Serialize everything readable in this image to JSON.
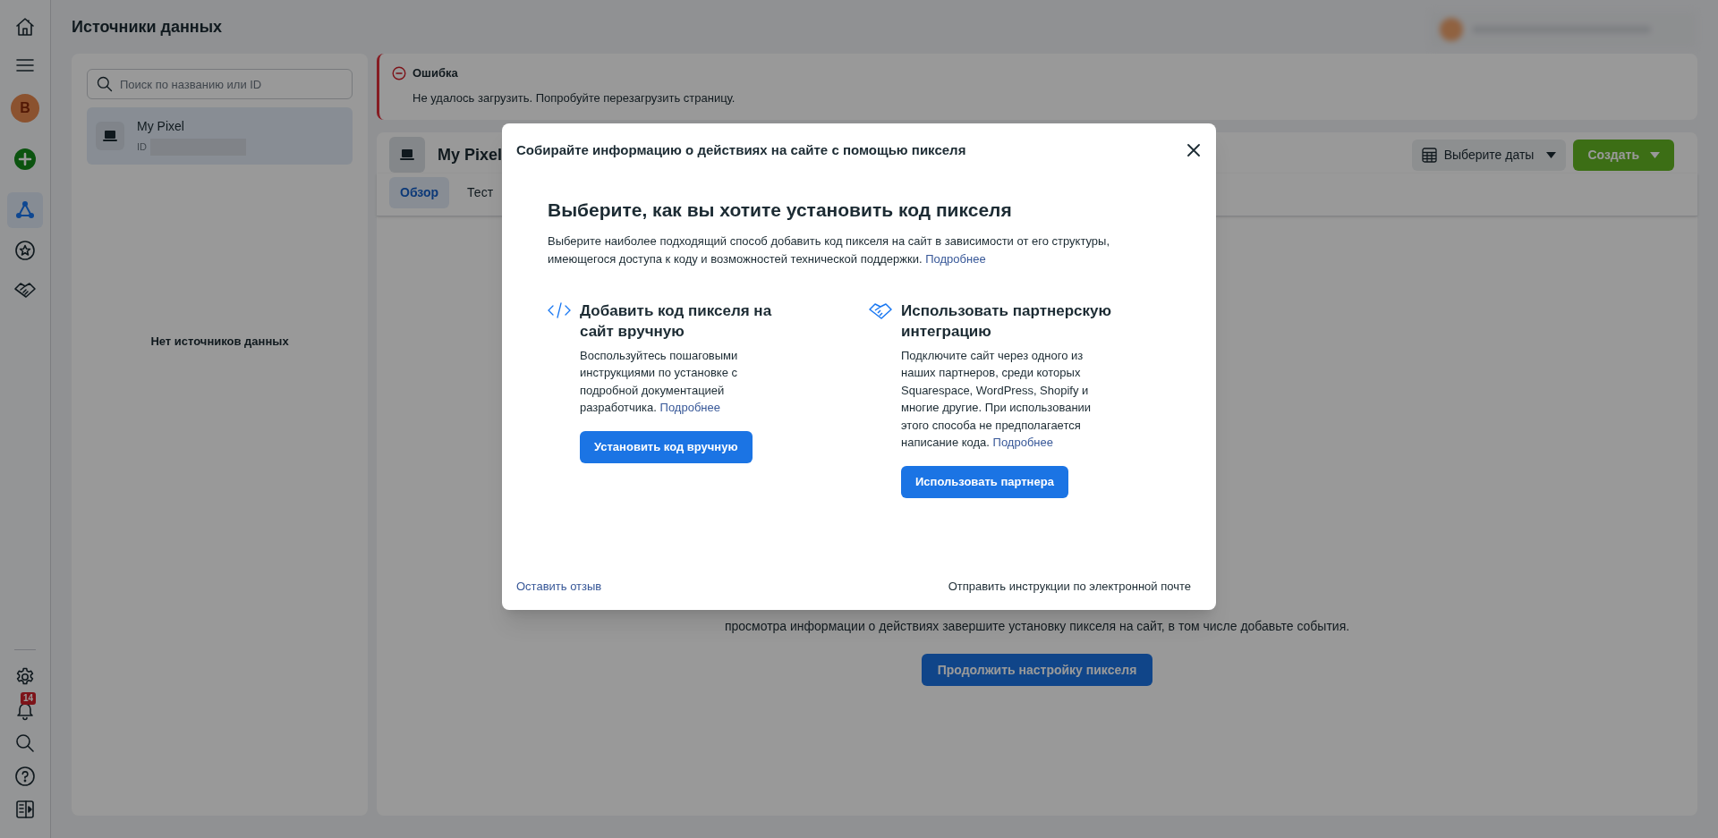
{
  "rail": {
    "top": [
      {
        "selected": false
      },
      {
        "selected": false
      },
      {
        "letter": "B",
        "selected": false
      },
      {
        "selected": false
      },
      {
        "selected": true
      },
      {
        "selected": false
      },
      {
        "selected": false
      }
    ],
    "bottom": [
      {
        "selected": false
      },
      {
        "selected": false,
        "badge": "14"
      },
      {
        "selected": false
      },
      {
        "selected": false
      },
      {
        "selected": false
      }
    ]
  },
  "page_title": "Источники данных",
  "sources": {
    "search": {
      "placeholder": "Поиск по названию или ID"
    },
    "items": [
      {
        "name": "My Pixel",
        "id_label": "ID",
        "selected": true
      }
    ],
    "empty_text": "Нет источников данных"
  },
  "error": {
    "title": "Ошибка",
    "message": "Не удалось загрузить. Попробуйте перезагрузить страницу."
  },
  "pixel": {
    "name": "My Pixel",
    "date_button": "Выберите даты",
    "create_button": "Создать",
    "tabs": [
      {
        "label": "Обзор",
        "selected": true
      },
      {
        "label": "Тест",
        "selected": false
      }
    ],
    "notice": "просмотра информации о действиях завершите установку пикселя на сайт, в том числе добавьте события.",
    "continue_button": "Продолжить настройку пикселя"
  },
  "modal": {
    "title": "Собирайте информацию о действиях на сайте с помощью пикселя",
    "heading": "Выберите, как вы хотите установить код пикселя",
    "intro": "Выберите наиболее подходящий способ добавить код пикселя на сайт в зависимости от его структуры, имеющегося доступа к коду и возможностей технической поддержки.",
    "intro_link": "Подробнее",
    "options": [
      {
        "kind": "code",
        "title": "Добавить код пикселя на сайт вручную",
        "text": "Воспользуйтесь пошаговыми инструкциями по установке с подробной документацией разработчика.",
        "link": "Подробнее",
        "button": "Установить код вручную"
      },
      {
        "kind": "partner",
        "title": "Использовать партнерскую интеграцию",
        "text": "Подключите сайт через одного из наших партнеров, среди которых Squarespace, WordPress, Shopify и многие другие. При использовании этого способа не предполагается написание кода.",
        "link": "Подробнее",
        "button": "Использовать партнера"
      }
    ],
    "feedback_link": "Оставить отзыв",
    "email_link": "Отправить инструкции по электронной почте"
  }
}
